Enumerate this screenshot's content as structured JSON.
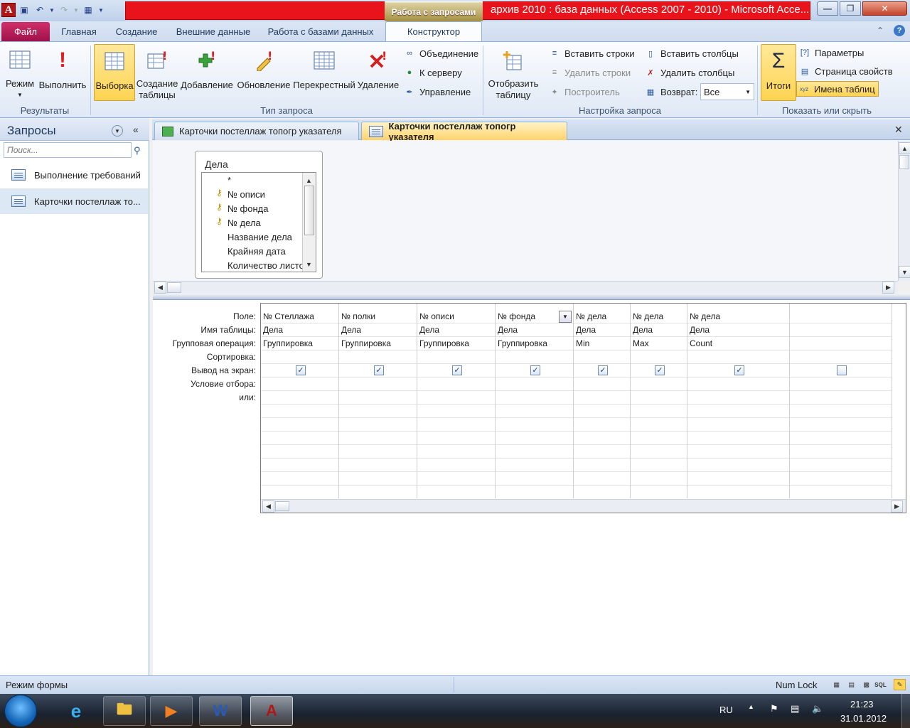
{
  "window": {
    "title": "архив 2010 : база данных (Access 2007 - 2010)  -  Microsoft Acce...",
    "context_tab_group": "Работа с запросами",
    "app_letter": "A"
  },
  "ribbon_tabs": [
    "Файл",
    "Главная",
    "Создание",
    "Внешние данные",
    "Работа с базами данных",
    "Конструктор"
  ],
  "ribbon": {
    "results": {
      "label": "Результаты",
      "mode": "Режим",
      "run": "Выполнить"
    },
    "query_type": {
      "label": "Тип запроса",
      "select": "Выборка",
      "make_table_1": "Создание",
      "make_table_2": "таблицы",
      "append": "Добавление",
      "update": "Обновление",
      "crosstab": "Перекрестный",
      "delete": "Удаление",
      "union": "Объединение",
      "passthrough": "К серверу",
      "data_def": "Управление"
    },
    "setup": {
      "label": "Настройка запроса",
      "show_table_1": "Отобразить",
      "show_table_2": "таблицу",
      "insert_rows": "Вставить строки",
      "delete_rows": "Удалить строки",
      "builder": "Построитель",
      "insert_cols": "Вставить столбцы",
      "delete_cols": "Удалить столбцы",
      "return_label": "Возврат:",
      "return_value": "Все"
    },
    "show_hide": {
      "label": "Показать или скрыть",
      "totals": "Итоги",
      "params": "Параметры",
      "prop_sheet": "Страница свойств",
      "table_names": "Имена таблиц"
    }
  },
  "nav": {
    "title": "Запросы",
    "search_placeholder": "Поиск...",
    "items": [
      "Выполнение требований",
      "Карточки постеллаж то..."
    ]
  },
  "doc_tabs": [
    "Карточки постеллаж топогр указателя",
    "Карточки постеллаж топогр указателя"
  ],
  "table": {
    "name": "Дела",
    "fields": [
      {
        "name": "*",
        "key": false
      },
      {
        "name": "№ описи",
        "key": true
      },
      {
        "name": "№ фонда",
        "key": true
      },
      {
        "name": "№ дела",
        "key": true
      },
      {
        "name": "Название дела",
        "key": false
      },
      {
        "name": "Крайняя дата",
        "key": false
      },
      {
        "name": "Количество листов",
        "key": false
      }
    ]
  },
  "grid": {
    "row_labels": [
      "Поле:",
      "Имя таблицы:",
      "Групповая операция:",
      "Сортировка:",
      "Вывод на экран:",
      "Условие отбора:",
      "или:"
    ],
    "columns": [
      {
        "field": "№ Стеллажа",
        "table": "Дела",
        "total": "Группировка",
        "show": true
      },
      {
        "field": "№ полки",
        "table": "Дела",
        "total": "Группировка",
        "show": true
      },
      {
        "field": "№ описи",
        "table": "Дела",
        "total": "Группировка",
        "show": true
      },
      {
        "field": "№ фонда",
        "table": "Дела",
        "total": "Группировка",
        "show": true
      },
      {
        "field": "№ дела",
        "table": "Дела",
        "total": "Min",
        "show": true
      },
      {
        "field": "№ дела",
        "table": "Дела",
        "total": "Max",
        "show": true
      },
      {
        "field": "№ дела",
        "table": "Дела",
        "total": "Count",
        "show": true
      },
      {
        "field": "",
        "table": "",
        "total": "",
        "show": false
      }
    ]
  },
  "status": {
    "mode": "Режим формы",
    "numlock": "Num Lock"
  },
  "taskbar": {
    "lang": "RU",
    "time": "21:23",
    "date": "31.01.2012"
  }
}
